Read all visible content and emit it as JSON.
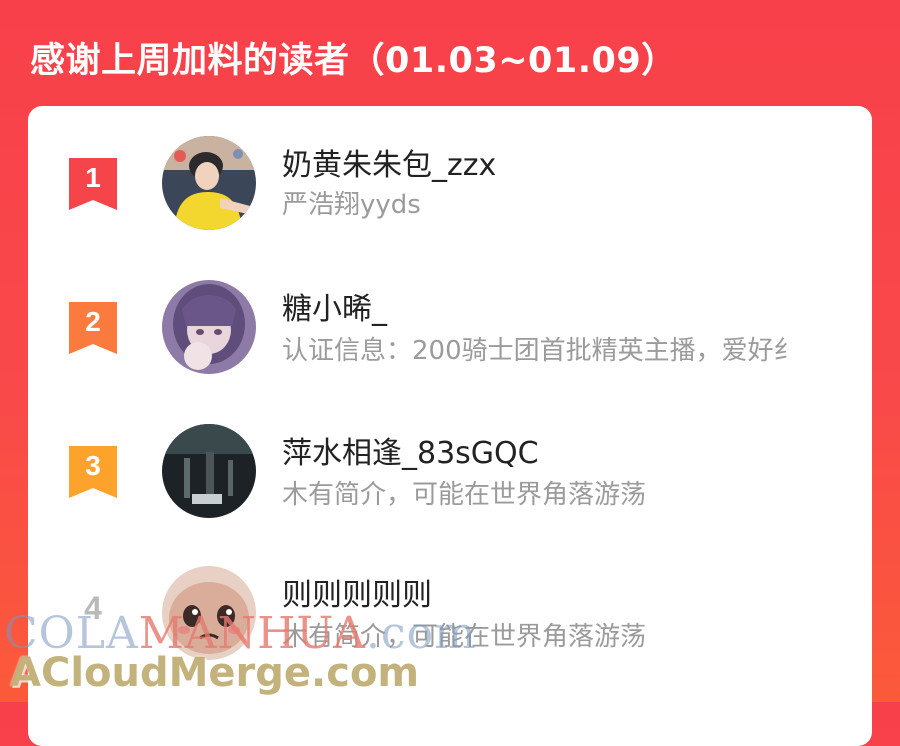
{
  "header": {
    "title": "感谢上周加料的读者（01.03~01.09）"
  },
  "readers": [
    {
      "rank": "1",
      "name": "奶黄朱朱包_zzx",
      "bio": "严浩翔yyds",
      "badge_color": "#f5444a",
      "avatar_icon": "avatar-yellow-shirt-icon"
    },
    {
      "rank": "2",
      "name": "糖小晞_",
      "bio": "认证信息：200骑士团首批精英主播，爱好纟",
      "badge_color": "#fb7a3d",
      "avatar_icon": "avatar-anime-girl-icon"
    },
    {
      "rank": "3",
      "name": "萍水相逢_83sGQC",
      "bio": "木有简介，可能在世界角落游荡",
      "badge_color": "#fda22a",
      "avatar_icon": "avatar-dark-photo-icon"
    },
    {
      "rank": "4",
      "name": "则则则则则",
      "bio": "木有简介，可能在世界角落游荡",
      "badge_color": "",
      "avatar_icon": "avatar-cartoon-face-icon"
    }
  ],
  "watermark": {
    "line1_prefix": "COLA",
    "line1_accent": "MANHUA",
    "line1_suffix": ".com",
    "line2": "ACloudMerge.com"
  },
  "colors": {
    "background_top": "#f8404a",
    "background_bottom": "#fb5a3a",
    "card": "#ffffff",
    "name_text": "#222222",
    "bio_text": "#9b9b9b"
  }
}
